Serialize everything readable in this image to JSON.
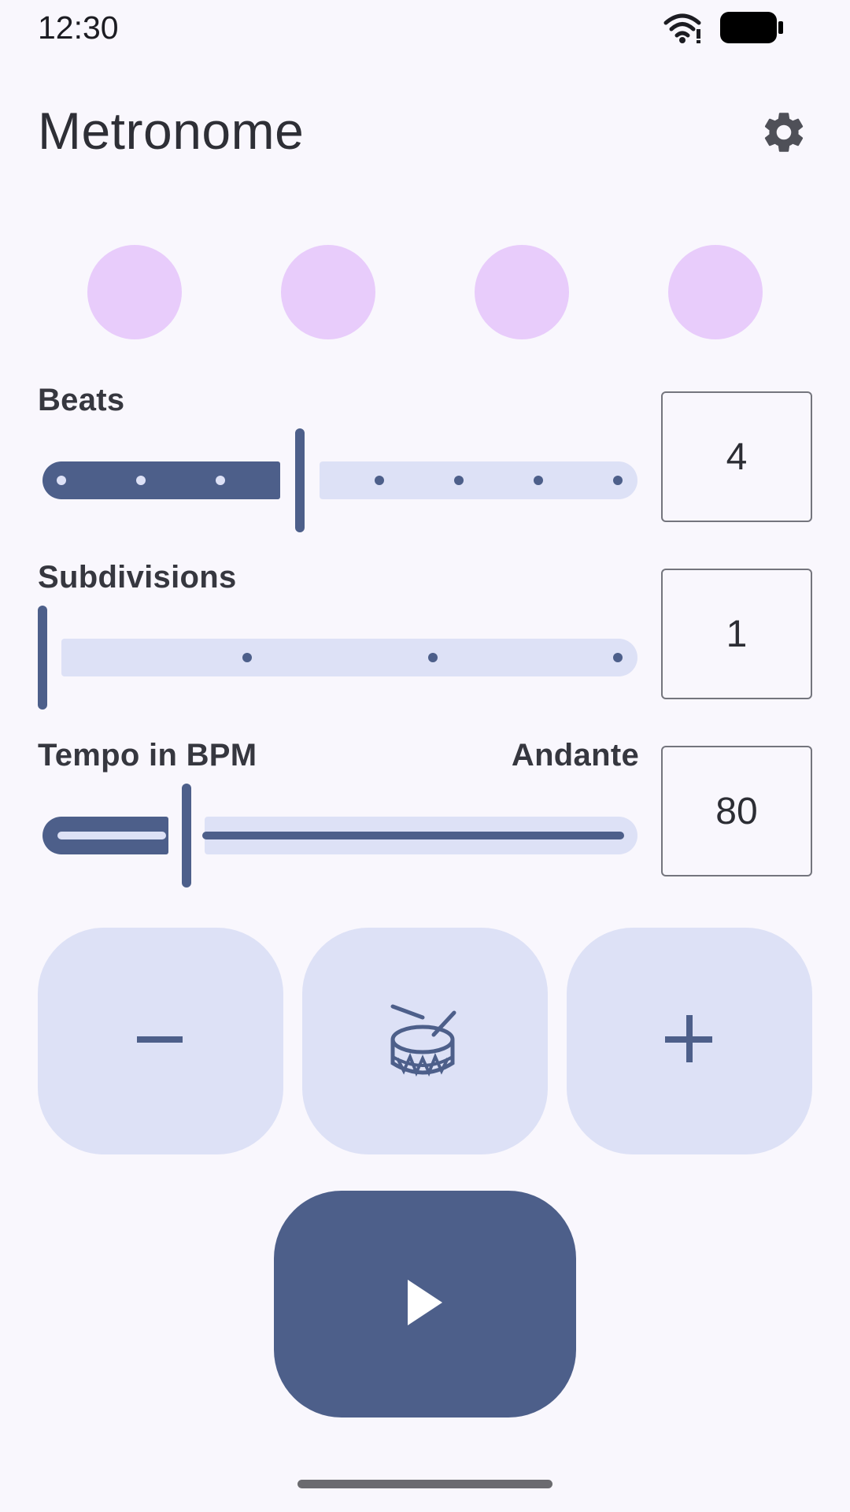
{
  "status_bar": {
    "time": "12:30"
  },
  "header": {
    "title": "Metronome"
  },
  "beat_indicators": {
    "count": 4,
    "active_color": "#e8ccfb"
  },
  "beats": {
    "label": "Beats",
    "value": "4",
    "slider_min": 1,
    "slider_max": 8,
    "slider_value": 4
  },
  "subdivisions": {
    "label": "Subdivisions",
    "value": "1",
    "slider_min": 1,
    "slider_max": 4,
    "slider_value": 1
  },
  "tempo": {
    "label": "Tempo in BPM",
    "marking": "Andante",
    "value": "80",
    "slider_fraction": 0.24
  },
  "controls": {
    "decrement_icon": "minus-icon",
    "tap_icon": "drum-icon",
    "increment_icon": "plus-icon",
    "play_icon": "play-icon"
  },
  "colors": {
    "primary": "#4d5f8a",
    "track_inactive": "#dde1f6",
    "background": "#f9f7fd"
  }
}
